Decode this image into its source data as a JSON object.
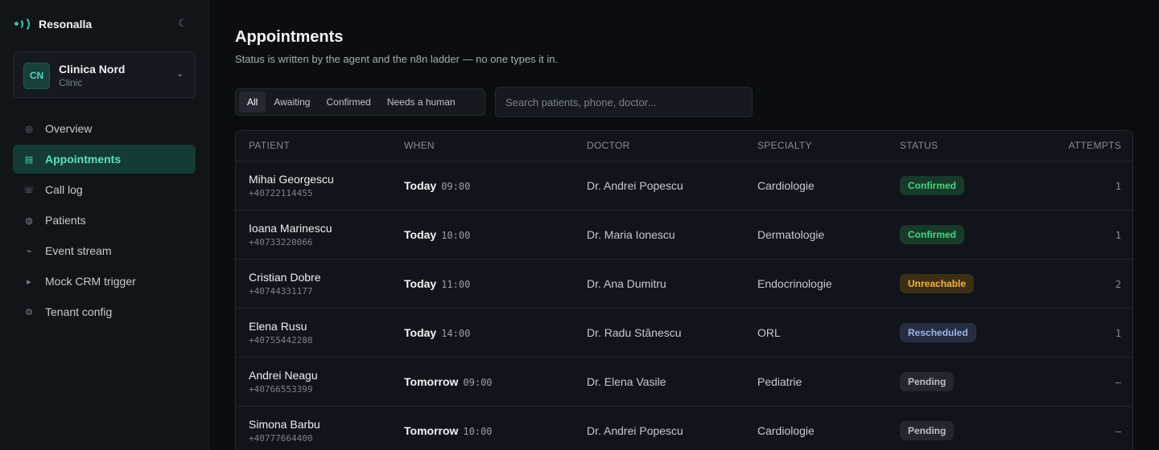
{
  "app": {
    "name": "Resonalla"
  },
  "tenant": {
    "initials": "CN",
    "name": "Clinica Nord",
    "type": "Clinic"
  },
  "nav": [
    {
      "label": "Overview",
      "icon": "overview-icon",
      "glyph": "◎",
      "active": false
    },
    {
      "label": "Appointments",
      "icon": "appointments-icon",
      "glyph": "▤",
      "active": true
    },
    {
      "label": "Call log",
      "icon": "call-log-icon",
      "glyph": "☏",
      "active": false
    },
    {
      "label": "Patients",
      "icon": "patients-icon",
      "glyph": "◍",
      "active": false
    },
    {
      "label": "Event stream",
      "icon": "event-stream-icon",
      "glyph": "⌁",
      "active": false
    },
    {
      "label": "Mock CRM trigger",
      "icon": "play-icon",
      "glyph": "▸",
      "active": false
    },
    {
      "label": "Tenant config",
      "icon": "gear-icon",
      "glyph": "⚙",
      "active": false
    }
  ],
  "page": {
    "title": "Appointments",
    "subtitle": "Status is written by the agent and the n8n ladder — no one types it in."
  },
  "filters": [
    "All",
    "Awaiting",
    "Confirmed",
    "Needs a human"
  ],
  "active_filter": "All",
  "search": {
    "placeholder": "Search patients, phone, doctor..."
  },
  "table": {
    "columns": [
      "PATIENT",
      "WHEN",
      "DOCTOR",
      "SPECIALTY",
      "STATUS",
      "ATTEMPTS"
    ],
    "rows": [
      {
        "name": "Mihai Georgescu",
        "phone": "+40722114455",
        "day": "Today",
        "time": "09:00",
        "doctor": "Dr. Andrei Popescu",
        "specialty": "Cardiologie",
        "status": "Confirmed",
        "status_kind": "confirmed",
        "attempts": "1"
      },
      {
        "name": "Ioana Marinescu",
        "phone": "+40733220066",
        "day": "Today",
        "time": "10:00",
        "doctor": "Dr. Maria Ionescu",
        "specialty": "Dermatologie",
        "status": "Confirmed",
        "status_kind": "confirmed",
        "attempts": "1"
      },
      {
        "name": "Cristian Dobre",
        "phone": "+40744331177",
        "day": "Today",
        "time": "11:00",
        "doctor": "Dr. Ana Dumitru",
        "specialty": "Endocrinologie",
        "status": "Unreachable",
        "status_kind": "unreachable",
        "attempts": "2"
      },
      {
        "name": "Elena Rusu",
        "phone": "+40755442288",
        "day": "Today",
        "time": "14:00",
        "doctor": "Dr. Radu Stănescu",
        "specialty": "ORL",
        "status": "Rescheduled",
        "status_kind": "rescheduled",
        "attempts": "1"
      },
      {
        "name": "Andrei Neagu",
        "phone": "+40766553399",
        "day": "Tomorrow",
        "time": "09:00",
        "doctor": "Dr. Elena Vasile",
        "specialty": "Pediatrie",
        "status": "Pending",
        "status_kind": "pending",
        "attempts": "–"
      },
      {
        "name": "Simona Barbu",
        "phone": "+40777664400",
        "day": "Tomorrow",
        "time": "10:00",
        "doctor": "Dr. Andrei Popescu",
        "specialty": "Cardiologie",
        "status": "Pending",
        "status_kind": "pending",
        "attempts": "–"
      }
    ]
  },
  "colors": {
    "accent": "#3fc1a8",
    "background": "#0b0d10",
    "sidebar": "#111419",
    "confirmed": "#45d583",
    "unreachable": "#f3b43c",
    "rescheduled": "#9fb3e6",
    "pending": "#b9bec5"
  }
}
